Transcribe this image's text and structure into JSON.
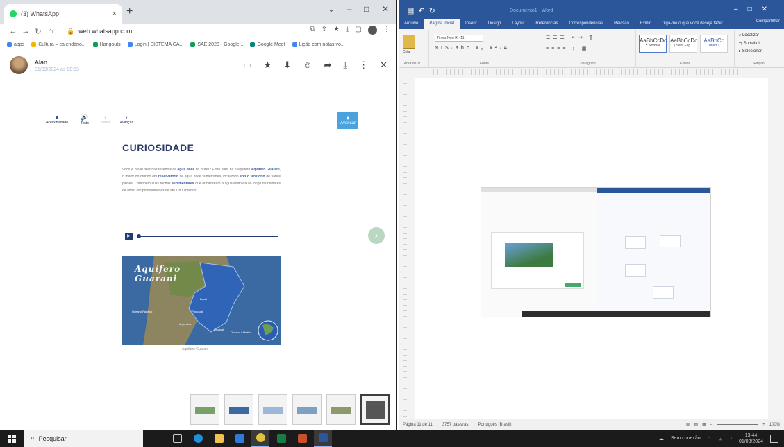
{
  "browser": {
    "tab_title": "(3) WhatsApp",
    "new_tab": "+",
    "url": "web.whatsapp.com",
    "bookmarks": [
      {
        "label": "apps",
        "color": "#4285f4"
      },
      {
        "label": "Cultura – calendário...",
        "color": "#f4b400"
      },
      {
        "label": "Hangouts",
        "color": "#0f9d58"
      },
      {
        "label": "Login | SISTEMA CA...",
        "color": "#4285f4"
      },
      {
        "label": "SAE 2020 - Google...",
        "color": "#0f9d58"
      },
      {
        "label": "Google Meet",
        "color": "#00897b"
      },
      {
        "label": "Lição com notas vo...",
        "color": "#4285f4"
      }
    ]
  },
  "chat": {
    "sender_name": "Alan",
    "timestamp": "01/03/2024 às 08:53",
    "actions": [
      "star-icon",
      "pin-icon",
      "emoji-icon",
      "forward-icon",
      "download-icon",
      "menu-icon",
      "close-icon"
    ]
  },
  "lesson": {
    "toolbar": [
      "Acessibilidade",
      "Texto",
      "Voltar",
      "Avançar"
    ],
    "next_button": "Avançar",
    "title": "CURIOSIDADE",
    "paragraph_parts": [
      "Você já ouviu falar das reservas de ",
      "água doce",
      " no Brasil? Entre elas, há o aquífero ",
      "Aquífero Guarani",
      ", o maior do mundo em ",
      "reservatório",
      " de água doce subterrânea, localizado ",
      "sob o território",
      " de vários países. Compõem suas rochas ",
      "sedimentares",
      " que armazenam a água infiltrada ao longo de milhares de anos, em profundidades de até 1.800 metros."
    ],
    "map_title_line1": "Aquífero",
    "map_title_line2": "Guarani",
    "map_labels": [
      "Brasil",
      "Paraguai",
      "Argentina",
      "Uruguai",
      "Oceano Pacífico",
      "Oceano Atlântico"
    ],
    "map_caption": "Aquífero Guarani"
  },
  "word": {
    "doc_title": "Documento1 - Word",
    "tabs": [
      "Arquivo",
      "Página Inicial",
      "Inserir",
      "Design",
      "Layout",
      "Referências",
      "Correspondências",
      "Revisão",
      "Exibir",
      "Diga-me o que você deseja fazer"
    ],
    "share": "Compartilhar",
    "group_labels": [
      "Área de Tr...",
      "Fonte",
      "Parágrafo",
      "Estilos",
      "Edição"
    ],
    "paste_label": "Colar",
    "font_name": "Times New R",
    "font_size": "11",
    "styles": [
      {
        "preview": "AaBbCcDc",
        "name": "¶ Normal"
      },
      {
        "preview": "AaBbCcDc",
        "name": "¶ Sem Esp..."
      },
      {
        "preview": "AaBbCc",
        "name": "Título 1"
      }
    ],
    "edit_items": [
      "Localizar",
      "Substituir",
      "Selecionar"
    ],
    "status": {
      "page": "Página 11 de 11",
      "words": "3757 palavras",
      "language": "Português (Brasil)",
      "zoom": "100%"
    }
  },
  "taskbar": {
    "search_placeholder": "Pesquisar",
    "tray_text": "Sem conexão",
    "time": "13:44",
    "date": "01/03/2024"
  },
  "colors": {
    "word_blue": "#2b579a",
    "lesson_title": "#2b3b66",
    "whatsapp_green": "#25d366"
  }
}
